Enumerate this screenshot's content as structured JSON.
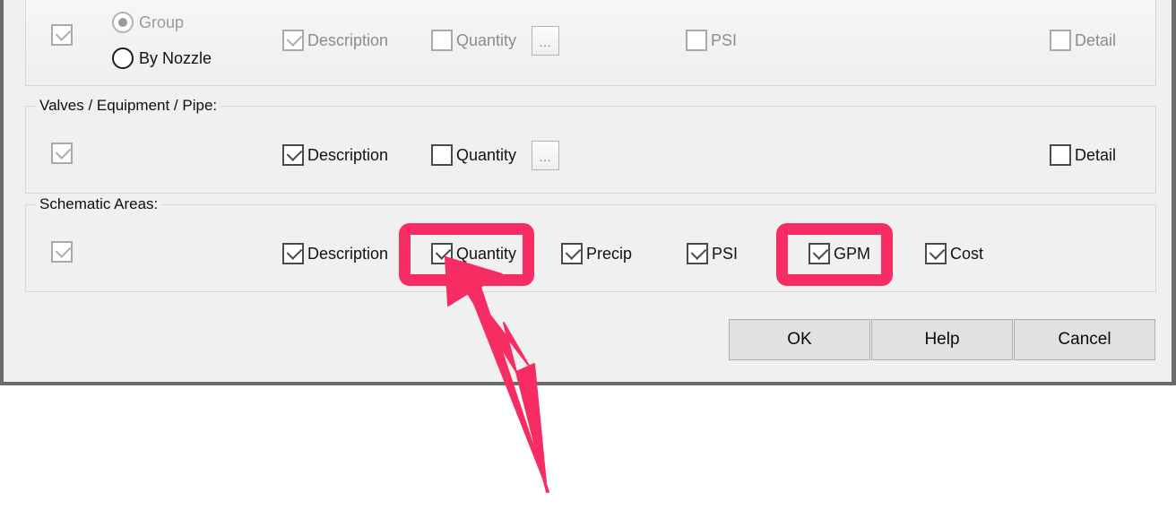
{
  "dialog": {
    "sections": [
      {
        "id": "sprinklers",
        "label": "",
        "master_checkbox": {
          "name": "master",
          "checked": true,
          "enabled": false
        },
        "radios": [
          {
            "label": "Group",
            "selected": true,
            "enabled": false
          },
          {
            "label": "By Nozzle",
            "selected": false,
            "enabled": true
          }
        ],
        "options": [
          {
            "label": "Description",
            "checked": true
          },
          {
            "label": "Quantity",
            "checked": false
          },
          {
            "label": "PSI",
            "checked": false
          },
          {
            "label": "Detail",
            "checked": false
          }
        ],
        "ellipsis_label": "..."
      },
      {
        "id": "valves",
        "label": "Valves / Equipment / Pipe:",
        "master_checkbox": {
          "name": "master",
          "checked": true,
          "enabled": false
        },
        "options": [
          {
            "label": "Description",
            "checked": true
          },
          {
            "label": "Quantity",
            "checked": false
          },
          {
            "label": "Detail",
            "checked": false
          }
        ],
        "ellipsis_label": "..."
      },
      {
        "id": "schematic",
        "label": "Schematic Areas:",
        "master_checkbox": {
          "name": "master",
          "checked": true,
          "enabled": false
        },
        "options": [
          {
            "label": "Description",
            "checked": true
          },
          {
            "label": "Quantity",
            "checked": true
          },
          {
            "label": "Precip",
            "checked": true
          },
          {
            "label": "PSI",
            "checked": true
          },
          {
            "label": "GPM",
            "checked": true
          },
          {
            "label": "Cost",
            "checked": true
          }
        ]
      }
    ],
    "buttons": [
      {
        "id": "ok",
        "label": "OK"
      },
      {
        "id": "help",
        "label": "Help"
      },
      {
        "id": "cancel",
        "label": "Cancel"
      }
    ]
  },
  "annotation": {
    "color": "#f72c63",
    "highlighted": [
      "Quantity",
      "GPM"
    ],
    "arrow_target": "Quantity"
  }
}
